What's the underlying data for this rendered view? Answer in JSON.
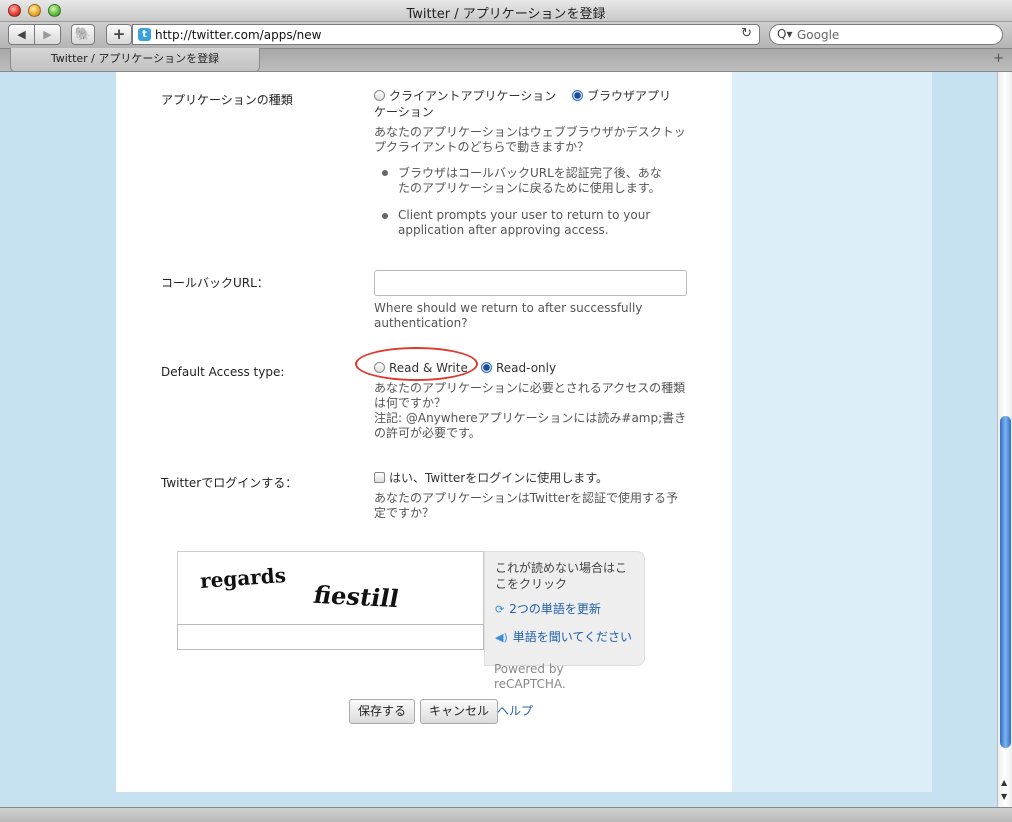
{
  "window": {
    "title": "Twitter / アプリケーションを登録"
  },
  "toolbar": {
    "back_icon": "◀",
    "forward_icon": "▶",
    "evernote_icon": "🐘",
    "add_icon": "+",
    "url": "http://twitter.com/apps/new",
    "reload_icon": "↻",
    "search_placeholder": "Google",
    "search_icon": "Q▾"
  },
  "tab": {
    "label": "Twitter / アプリケーションを登録",
    "new_tab_icon": "+"
  },
  "form": {
    "app_type": {
      "label": "アプリケーションの種類",
      "option_client": "クライアントアプリケーション",
      "option_browser_1": "ブラウザアプリ",
      "option_browser_2": "ケーション",
      "selected": "browser",
      "help_1": "あなたのアプリケーションはウェブブラウザかデスクトッ",
      "help_2": "プクライアントのどちらで動きますか？",
      "bullet1_1": "ブラウザはコールバックURLを認証完了後、あな",
      "bullet1_2": "たのアプリケーションに戻るために使用します。",
      "bullet2_1": "Client prompts your user to return to your",
      "bullet2_2": "application after approving access."
    },
    "callback": {
      "label": "コールバックURL：",
      "value": "",
      "help_1": "Where should we return to after successfully",
      "help_2": "authentication?"
    },
    "access": {
      "label": "Default Access type:",
      "option_rw": "Read & Write",
      "option_ro": "Read-only",
      "selected": "read-only",
      "help_1": "あなたのアプリケーションに必要とされるアクセスの種類",
      "help_2": "は何ですか？",
      "help_3": "注記: @Anywhereアプリケーションには読み#amp;書き",
      "help_4": "の許可が必要です。"
    },
    "login": {
      "label": "Twitterでログインする：",
      "checkbox_label": "はい、Twitterをログインに使用します。",
      "checked": false,
      "help_1": "あなたのアプリケーションはTwitterを認証で使用する予",
      "help_2": "定ですか？"
    }
  },
  "captcha": {
    "word1": "regards",
    "word2": "fiestill",
    "input_value": "",
    "cant_read_1": "これが読めない場合はこ",
    "cant_read_2": "こをクリック",
    "refresh_label": "2つの単語を更新",
    "audio_label": "単語を聞いてください",
    "powered_1": "Powered by",
    "powered_2": "reCAPTCHA."
  },
  "actions": {
    "save": "保存する",
    "cancel": "キャンセル",
    "help": "ヘルプ"
  },
  "colors": {
    "link": "#1f5fa8",
    "annotation": "#e0392e",
    "page_bg": "#c6e1f0"
  }
}
